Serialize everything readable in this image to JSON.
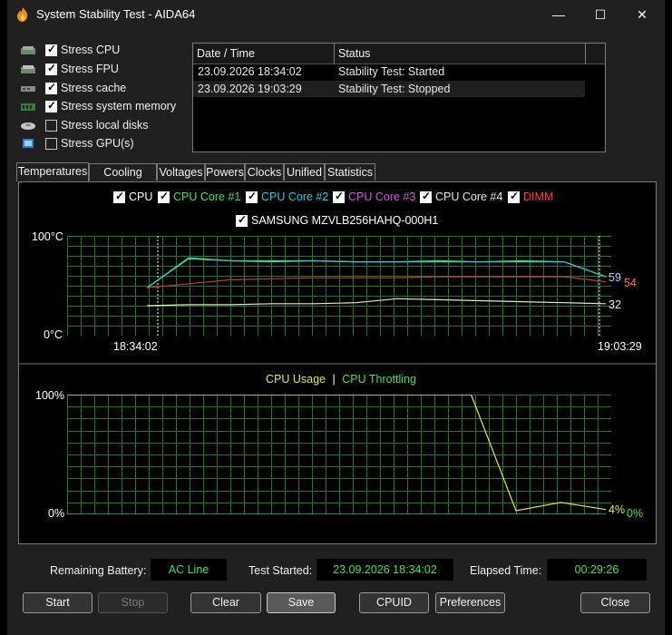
{
  "window": {
    "title": "System Stability Test - AIDA64",
    "controls": [
      "—",
      "☐",
      "✕"
    ]
  },
  "stress_options": [
    {
      "label": "Stress CPU",
      "checked": true,
      "icon": "cpu-icon"
    },
    {
      "label": "Stress FPU",
      "checked": true,
      "icon": "fpu-icon"
    },
    {
      "label": "Stress cache",
      "checked": true,
      "icon": "cache-icon"
    },
    {
      "label": "Stress system memory",
      "checked": true,
      "icon": "memory-icon"
    },
    {
      "label": "Stress local disks",
      "checked": false,
      "icon": "disk-icon"
    },
    {
      "label": "Stress GPU(s)",
      "checked": false,
      "icon": "gpu-icon"
    }
  ],
  "log": {
    "columns": [
      "Date / Time",
      "Status"
    ],
    "rows": [
      [
        "23.09.2026 18:34:02",
        "Stability Test: Started"
      ],
      [
        "23.09.2026 19:03:29",
        "Stability Test: Stopped"
      ]
    ]
  },
  "tabs": [
    "Temperatures",
    "Cooling Fans",
    "Voltages",
    "Powers",
    "Clocks",
    "Unified",
    "Statistics"
  ],
  "active_tab": "Temperatures",
  "temp_graph": {
    "legend": [
      {
        "label": "CPU",
        "color": "#ffffff",
        "checked": true
      },
      {
        "label": "CPU Core #1",
        "color": "#44e25a",
        "checked": true
      },
      {
        "label": "CPU Core #2",
        "color": "#33c6e0",
        "checked": true
      },
      {
        "label": "CPU Core #3",
        "color": "#d25ae6",
        "checked": true
      },
      {
        "label": "CPU Core #4",
        "color": "#e6e6e6",
        "checked": true
      },
      {
        "label": "DIMM",
        "color": "#ff4040",
        "checked": true
      },
      {
        "label": "SAMSUNG MZVLB256HAHQ-000H1",
        "color": "#ffffff",
        "checked": true
      }
    ],
    "y_top_label": "100°C",
    "y_bottom_label": "0°C",
    "x_start_label": "18:34:02",
    "x_end_label": "19:03:29",
    "end_values": [
      {
        "text": "59",
        "color": "#aad0ff"
      },
      {
        "text": "54",
        "color": "#ff6a6a"
      },
      {
        "text": "32",
        "color": "#f0f0d0"
      }
    ]
  },
  "usage_graph": {
    "legend_usage": "CPU Usage",
    "legend_sep": "|",
    "legend_throttling": "CPU Throttling",
    "usage_color": "#e8e84a",
    "throttle_color": "#44e25a",
    "y_top_label": "100%",
    "y_bottom_label": "0%",
    "end_usage": "4%",
    "end_throttle": "0%"
  },
  "status": {
    "battery_label": "Remaining Battery:",
    "battery_value": "AC Line",
    "started_label": "Test Started:",
    "started_value": "23.09.2026 18:34:02",
    "elapsed_label": "Elapsed Time:",
    "elapsed_value": "00:29:26"
  },
  "buttons": {
    "start": "Start",
    "stop": "Stop",
    "clear": "Clear",
    "save": "Save",
    "cpuid": "CPUID",
    "preferences": "Preferences",
    "close": "Close"
  },
  "chart_data": [
    {
      "type": "line",
      "y_unit": "°C",
      "ylim": [
        0,
        100
      ],
      "x": [
        "18:34:02",
        "19:03:29"
      ],
      "series": [
        {
          "name": "CPU Core #1",
          "values_approx": [
            48,
            78,
            75,
            75,
            75,
            74,
            74,
            75,
            74,
            75,
            74,
            59
          ]
        },
        {
          "name": "CPU Core #2",
          "values_approx": [
            48,
            77,
            75,
            74,
            75,
            74,
            74,
            74,
            74,
            74,
            74,
            59
          ]
        },
        {
          "name": "DIMM",
          "values_approx": [
            48,
            52,
            56,
            57,
            58,
            58,
            58,
            59,
            59,
            59,
            59,
            54
          ]
        },
        {
          "name": "SAMSUNG MZVLB256HAHQ-000H1",
          "values_approx": [
            30,
            31,
            31,
            32,
            32,
            33,
            37,
            36,
            35,
            34,
            33,
            32
          ]
        }
      ],
      "end_labels": [
        59,
        54,
        32
      ]
    },
    {
      "type": "line",
      "y_unit": "%",
      "ylim": [
        0,
        100
      ],
      "series": [
        {
          "name": "CPU Usage",
          "values_approx": [
            100,
            100,
            100,
            100,
            100,
            100,
            100,
            100,
            100,
            100,
            3,
            10,
            4
          ]
        },
        {
          "name": "CPU Throttling",
          "values_approx": [
            0,
            0,
            0,
            0,
            0,
            0,
            0,
            0,
            0,
            0,
            0,
            0,
            0
          ]
        }
      ],
      "end_labels": [
        "4%",
        "0%"
      ]
    }
  ]
}
